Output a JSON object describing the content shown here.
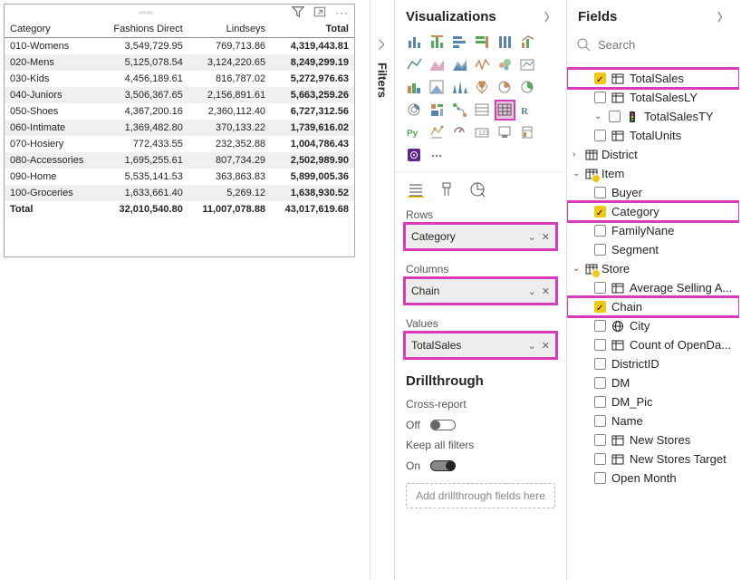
{
  "visual": {
    "columns": [
      "Category",
      "Fashions Direct",
      "Lindseys",
      "Total"
    ],
    "rows": [
      {
        "cat": "010-Womens",
        "fd": "3,549,729.95",
        "li": "769,713.86",
        "tot": "4,319,443.81"
      },
      {
        "cat": "020-Mens",
        "fd": "5,125,078.54",
        "li": "3,124,220.65",
        "tot": "8,249,299.19"
      },
      {
        "cat": "030-Kids",
        "fd": "4,456,189.61",
        "li": "816,787.02",
        "tot": "5,272,976.63"
      },
      {
        "cat": "040-Juniors",
        "fd": "3,506,367.65",
        "li": "2,156,891.61",
        "tot": "5,663,259.26"
      },
      {
        "cat": "050-Shoes",
        "fd": "4,367,200.16",
        "li": "2,360,112.40",
        "tot": "6,727,312.56"
      },
      {
        "cat": "060-Intimate",
        "fd": "1,369,482.80",
        "li": "370,133.22",
        "tot": "1,739,616.02"
      },
      {
        "cat": "070-Hosiery",
        "fd": "772,433.55",
        "li": "232,352.88",
        "tot": "1,004,786.43"
      },
      {
        "cat": "080-Accessories",
        "fd": "1,695,255.61",
        "li": "807,734.29",
        "tot": "2,502,989.90"
      },
      {
        "cat": "090-Home",
        "fd": "5,535,141.53",
        "li": "363,863.83",
        "tot": "5,899,005.36"
      },
      {
        "cat": "100-Groceries",
        "fd": "1,633,661.40",
        "li": "5,269.12",
        "tot": "1,638,930.52"
      }
    ],
    "grand_total": {
      "label": "Total",
      "fd": "32,010,540.80",
      "li": "11,007,078.88",
      "tot": "43,017,619.68"
    }
  },
  "filters_rail": "Filters",
  "viz": {
    "title": "Visualizations",
    "wells": {
      "rows_label": "Rows",
      "rows_value": "Category",
      "cols_label": "Columns",
      "cols_value": "Chain",
      "vals_label": "Values",
      "vals_value": "TotalSales"
    },
    "drill": {
      "title": "Drillthrough",
      "cross_label": "Cross-report",
      "off": "Off",
      "keep_label": "Keep all filters",
      "on": "On",
      "dropzone": "Add drillthrough fields here"
    }
  },
  "fields": {
    "title": "Fields",
    "search_placeholder": "Search",
    "root_items": [
      {
        "label": "TotalSales",
        "icon": "table",
        "checked": true,
        "highlight": true
      },
      {
        "label": "TotalSalesLY",
        "icon": "table",
        "checked": false
      },
      {
        "label": "TotalSalesTY",
        "icon": "traffic-light",
        "checked": false,
        "expandable": true
      },
      {
        "label": "TotalUnits",
        "icon": "table",
        "checked": false
      }
    ],
    "tables": [
      {
        "name": "District",
        "expanded": false,
        "yellow": false,
        "items": []
      },
      {
        "name": "Item",
        "expanded": true,
        "yellow": true,
        "items": [
          {
            "label": "Buyer",
            "checked": false
          },
          {
            "label": "Category",
            "checked": true,
            "highlight": true
          },
          {
            "label": "FamilyNane",
            "checked": false
          },
          {
            "label": "Segment",
            "checked": false
          }
        ]
      },
      {
        "name": "Store",
        "expanded": true,
        "yellow": true,
        "items": [
          {
            "label": "Average Selling A...",
            "checked": false,
            "icon": "table"
          },
          {
            "label": "Chain",
            "checked": true,
            "highlight": true
          },
          {
            "label": "City",
            "checked": false,
            "icon": "globe"
          },
          {
            "label": "Count of OpenDa...",
            "checked": false,
            "icon": "table"
          },
          {
            "label": "DistrictID",
            "checked": false
          },
          {
            "label": "DM",
            "checked": false
          },
          {
            "label": "DM_Pic",
            "checked": false
          },
          {
            "label": "Name",
            "checked": false
          },
          {
            "label": "New Stores",
            "checked": false,
            "icon": "table"
          },
          {
            "label": "New Stores Target",
            "checked": false,
            "icon": "table"
          },
          {
            "label": "Open Month",
            "checked": false
          }
        ]
      }
    ]
  }
}
